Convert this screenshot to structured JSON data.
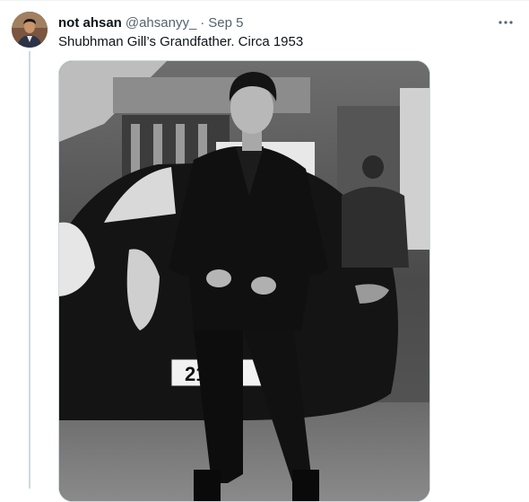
{
  "tweet": {
    "display_name": "not ahsan",
    "handle": "@ahsanyy_",
    "separator": "·",
    "date": "Sep 5",
    "text": "Shubhman Gill’s Grandfather. Circa 1953",
    "more_icon": "more-horizontal-icon"
  },
  "media": {
    "style": "black-and-white photo",
    "license_plate_text": "21 NU"
  },
  "colors": {
    "text_primary": "#0f1419",
    "text_secondary": "#536471",
    "border": "#cfd9de"
  }
}
